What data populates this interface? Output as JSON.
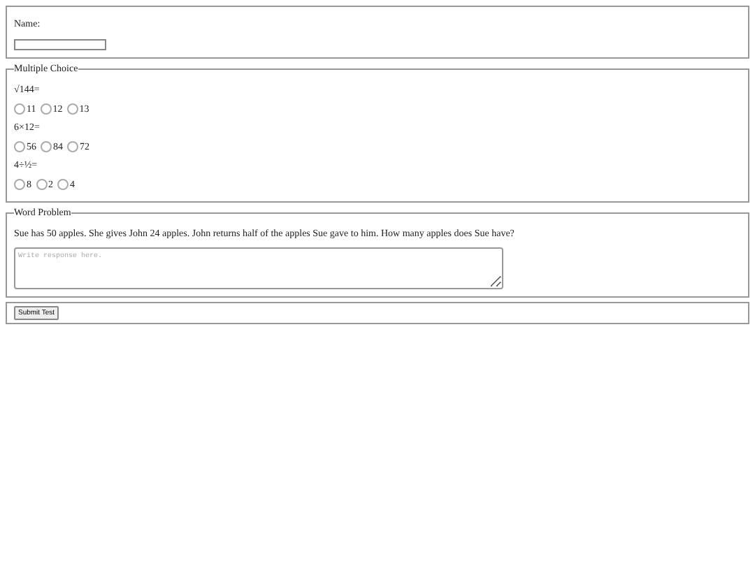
{
  "name_section": {
    "label": "Name:"
  },
  "multiple_choice": {
    "legend": "Multiple Choice",
    "questions": [
      {
        "prompt": "√144=",
        "options": [
          {
            "label": "11",
            "selected": false
          },
          {
            "label": "12",
            "selected": false
          },
          {
            "label": "13",
            "selected": false
          }
        ]
      },
      {
        "prompt": "6×12=",
        "options": [
          {
            "label": "56",
            "selected": false
          },
          {
            "label": "84",
            "selected": false
          },
          {
            "label": "72",
            "selected": false
          }
        ]
      },
      {
        "prompt": "4÷½=",
        "options": [
          {
            "label": "8",
            "selected": false
          },
          {
            "label": "2",
            "selected": false
          },
          {
            "label": "4",
            "selected": false
          }
        ]
      }
    ]
  },
  "word_problem": {
    "legend": "Word Problem",
    "question": "Sue has 50 apples. She gives John 24 apples. John returns half of the apples Sue gave to him. How many apples does Sue have?",
    "placeholder": "Write response here."
  },
  "submit": {
    "label": "Submit Test"
  }
}
